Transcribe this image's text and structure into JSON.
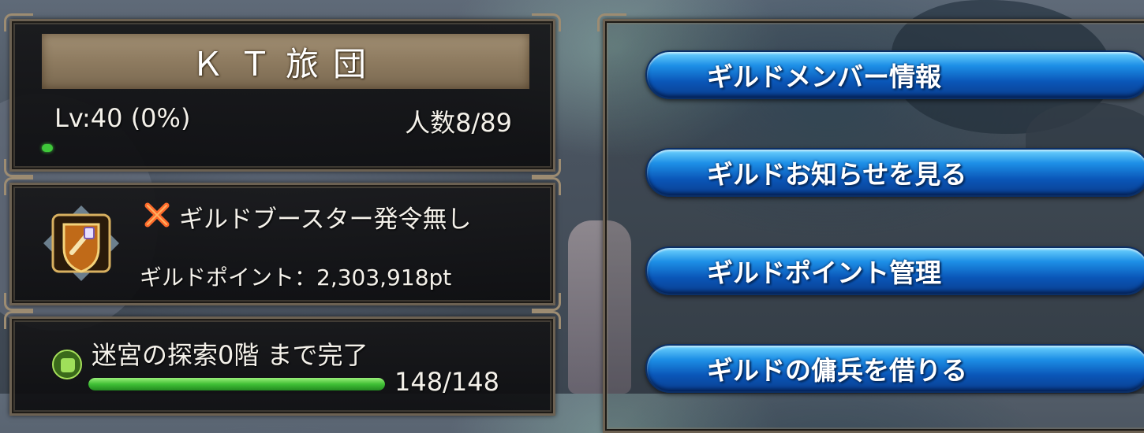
{
  "guild": {
    "name": "ＫＴ旅団",
    "level_text": "Lv:40 (0%)",
    "members_text": "人数8/89",
    "level_progress": 0
  },
  "booster": {
    "status_text": "ギルドブースター発令無し",
    "points_text": "ギルドポイント：2,303,918pt",
    "status_icon": "x-mark-icon",
    "emblem_icon": "guild-booster-emblem-icon"
  },
  "labyrinth": {
    "text": "迷宮の探索0階 まで完了",
    "progress_text": "148/148",
    "progress": 1.0,
    "icon": "green-fist-icon"
  },
  "menu": [
    {
      "label": "ギルドメンバー情報"
    },
    {
      "label": "ギルドお知らせを見る"
    },
    {
      "label": "ギルドポイント管理"
    },
    {
      "label": "ギルドの傭兵を借りる"
    }
  ],
  "colors": {
    "button_blue": "#0a56b8",
    "panel_border": "#6c6152",
    "banner_bg": "#8e7b60",
    "progress_green": "#3fbf35"
  }
}
